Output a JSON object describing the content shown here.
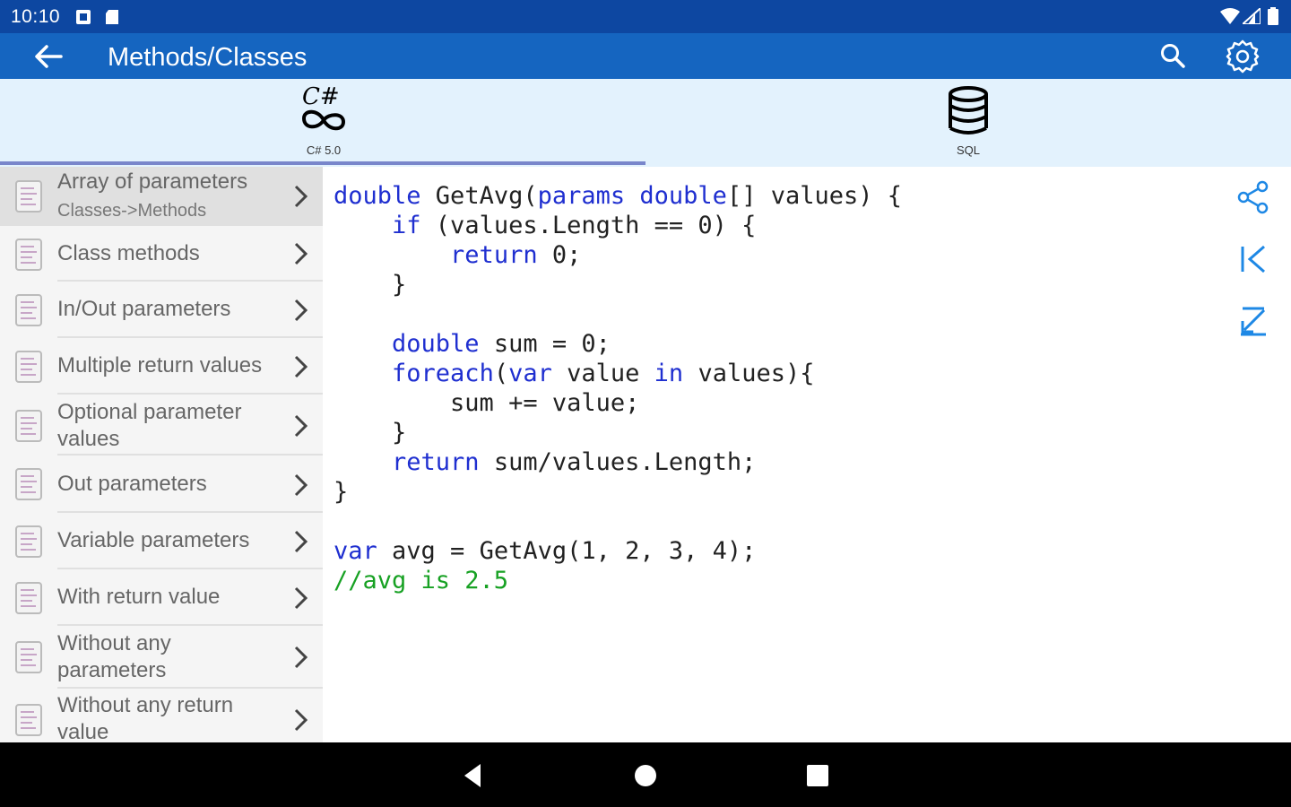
{
  "status_bar": {
    "time": "10:10",
    "left_icons": [
      "notification-icon",
      "sd-card-icon"
    ],
    "right_icons": [
      "wifi-icon",
      "signal-icon",
      "battery-icon"
    ]
  },
  "app_bar": {
    "title": "Methods/Classes",
    "back_icon": "back-arrow-icon",
    "actions": [
      "search-icon",
      "settings-icon"
    ],
    "background": "#1565c0"
  },
  "tabs": [
    {
      "label": "C# 5.0",
      "icon": "csharp-logo-icon",
      "selected": true
    },
    {
      "label": "SQL",
      "icon": "database-icon",
      "selected": false
    }
  ],
  "sidebar": {
    "items": [
      {
        "title": "Array of parameters",
        "subtitle": "Classes->Methods",
        "active": true
      },
      {
        "title": "Class methods"
      },
      {
        "title": "In/Out parameters"
      },
      {
        "title": "Multiple return values"
      },
      {
        "title": "Optional parameter values"
      },
      {
        "title": "Out parameters"
      },
      {
        "title": "Variable parameters"
      },
      {
        "title": "With return value"
      },
      {
        "title": "Without any parameters"
      },
      {
        "title": "Without any return value"
      }
    ]
  },
  "code": {
    "lines": [
      [
        {
          "t": "double",
          "k": "kw"
        },
        {
          "t": " GetAvg("
        },
        {
          "t": "params",
          "k": "kw"
        },
        {
          "t": " "
        },
        {
          "t": "double",
          "k": "kw"
        },
        {
          "t": "[] values) {"
        }
      ],
      [
        {
          "t": "    "
        },
        {
          "t": "if",
          "k": "kw"
        },
        {
          "t": " (values.Length == 0) {"
        }
      ],
      [
        {
          "t": "        "
        },
        {
          "t": "return",
          "k": "kw"
        },
        {
          "t": " 0;"
        }
      ],
      [
        {
          "t": "    }"
        }
      ],
      [
        {
          "t": ""
        }
      ],
      [
        {
          "t": "    "
        },
        {
          "t": "double",
          "k": "kw"
        },
        {
          "t": " sum = 0;"
        }
      ],
      [
        {
          "t": "    "
        },
        {
          "t": "foreach",
          "k": "kw"
        },
        {
          "t": "("
        },
        {
          "t": "var",
          "k": "kw"
        },
        {
          "t": " value "
        },
        {
          "t": "in",
          "k": "kw"
        },
        {
          "t": " values){"
        }
      ],
      [
        {
          "t": "        sum += value;"
        }
      ],
      [
        {
          "t": "    }"
        }
      ],
      [
        {
          "t": "    "
        },
        {
          "t": "return",
          "k": "kw"
        },
        {
          "t": " sum/values.Length;"
        }
      ],
      [
        {
          "t": "}"
        }
      ],
      [
        {
          "t": ""
        }
      ],
      [
        {
          "t": "var",
          "k": "kw"
        },
        {
          "t": " avg = GetAvg(1, 2, 3, 4);"
        }
      ],
      [
        {
          "t": "//avg is 2.5",
          "k": "cm"
        }
      ]
    ],
    "keyword_color": "#1f2fd0",
    "comment_color": "#17a123"
  },
  "right_actions": [
    "share-icon",
    "jump-to-first-icon",
    "jump-to-last-icon"
  ],
  "nav_bar": [
    "nav-back-icon",
    "nav-home-icon",
    "nav-recents-icon"
  ]
}
